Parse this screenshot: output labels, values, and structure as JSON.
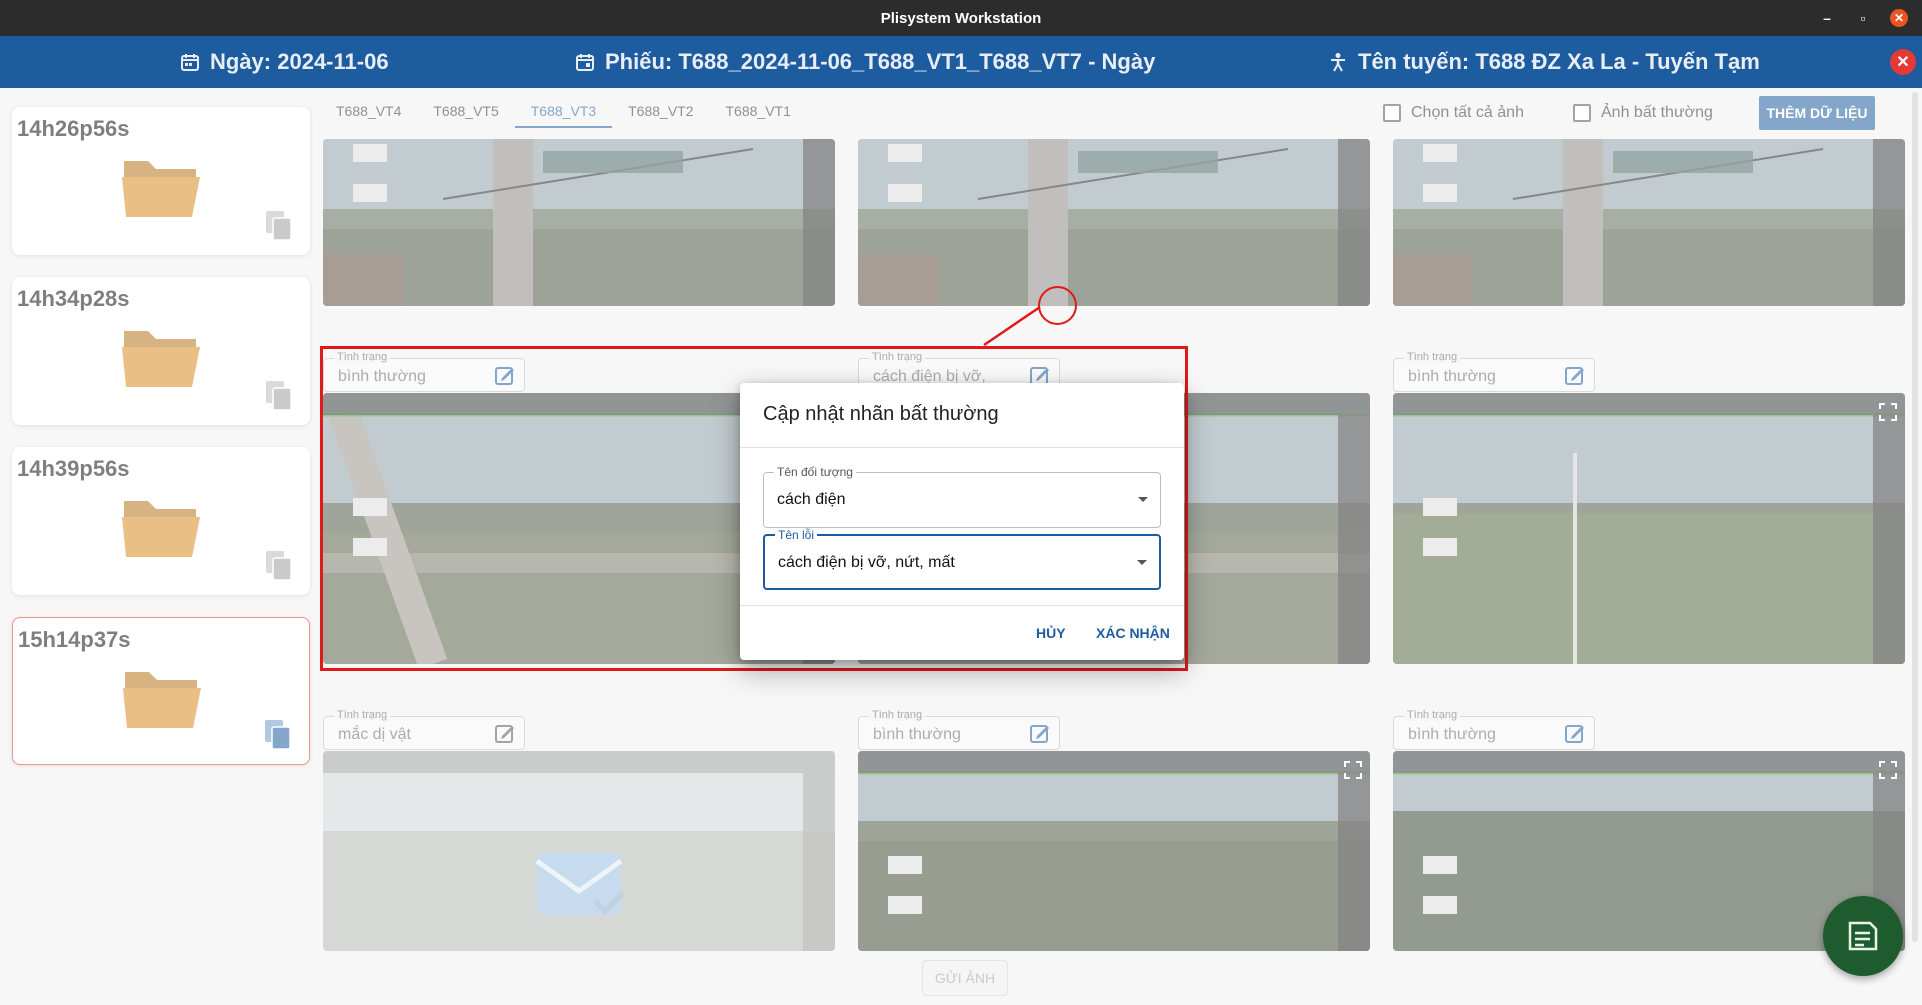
{
  "window": {
    "title": "Plisystem Workstation"
  },
  "header": {
    "date": "Ngày: 2024-11-06",
    "ticket": "Phiếu: T688_2024-11-06_T688_VT1_T688_VT7 - Ngày",
    "route": "Tên tuyến: T688 ĐZ Xa La - Tuyến Tạm",
    "date_icon": "calendar-icon",
    "ticket_icon": "calendar-icon",
    "route_icon": "person-icon",
    "colors": {
      "header_bg": "#1d5c9f",
      "accent_red": "#e53935",
      "folder": "#d68a1f"
    }
  },
  "sidebar": {
    "folders": [
      {
        "time": "14h26p56s",
        "active": false
      },
      {
        "time": "14h34p28s",
        "active": false
      },
      {
        "time": "14h39p56s",
        "active": false
      },
      {
        "time": "15h14p37s",
        "active": true
      }
    ]
  },
  "tabs": [
    {
      "label": "T688_VT4",
      "active": false
    },
    {
      "label": "T688_VT5",
      "active": false
    },
    {
      "label": "T688_VT3",
      "active": true
    },
    {
      "label": "T688_VT2",
      "active": false
    },
    {
      "label": "T688_VT1",
      "active": false
    }
  ],
  "controls": {
    "select_all": "Chọn tất cả ảnh",
    "abnormal": "Ảnh bất thường",
    "add_data": "THÊM DỮ LIỆU"
  },
  "status_label": "Tình trạng",
  "images": [
    {
      "status": "bình thường"
    },
    {
      "status": "cách điện bị vỡ,"
    },
    {
      "status": "bình thường"
    },
    {
      "status": "mắc dị vật"
    },
    {
      "status": "bình thường"
    },
    {
      "status": "bình thường"
    }
  ],
  "dialog": {
    "title": "Cập nhật nhãn bất thường",
    "object_label": "Tên đối tượng",
    "object_value": "cách điện",
    "error_label": "Tên lỗi",
    "error_value": "cách điện bị vỡ, nứt, mất",
    "cancel": "HỦY",
    "confirm": "XÁC NHẬN"
  },
  "footer": {
    "send": "GỬI ẢNH"
  }
}
